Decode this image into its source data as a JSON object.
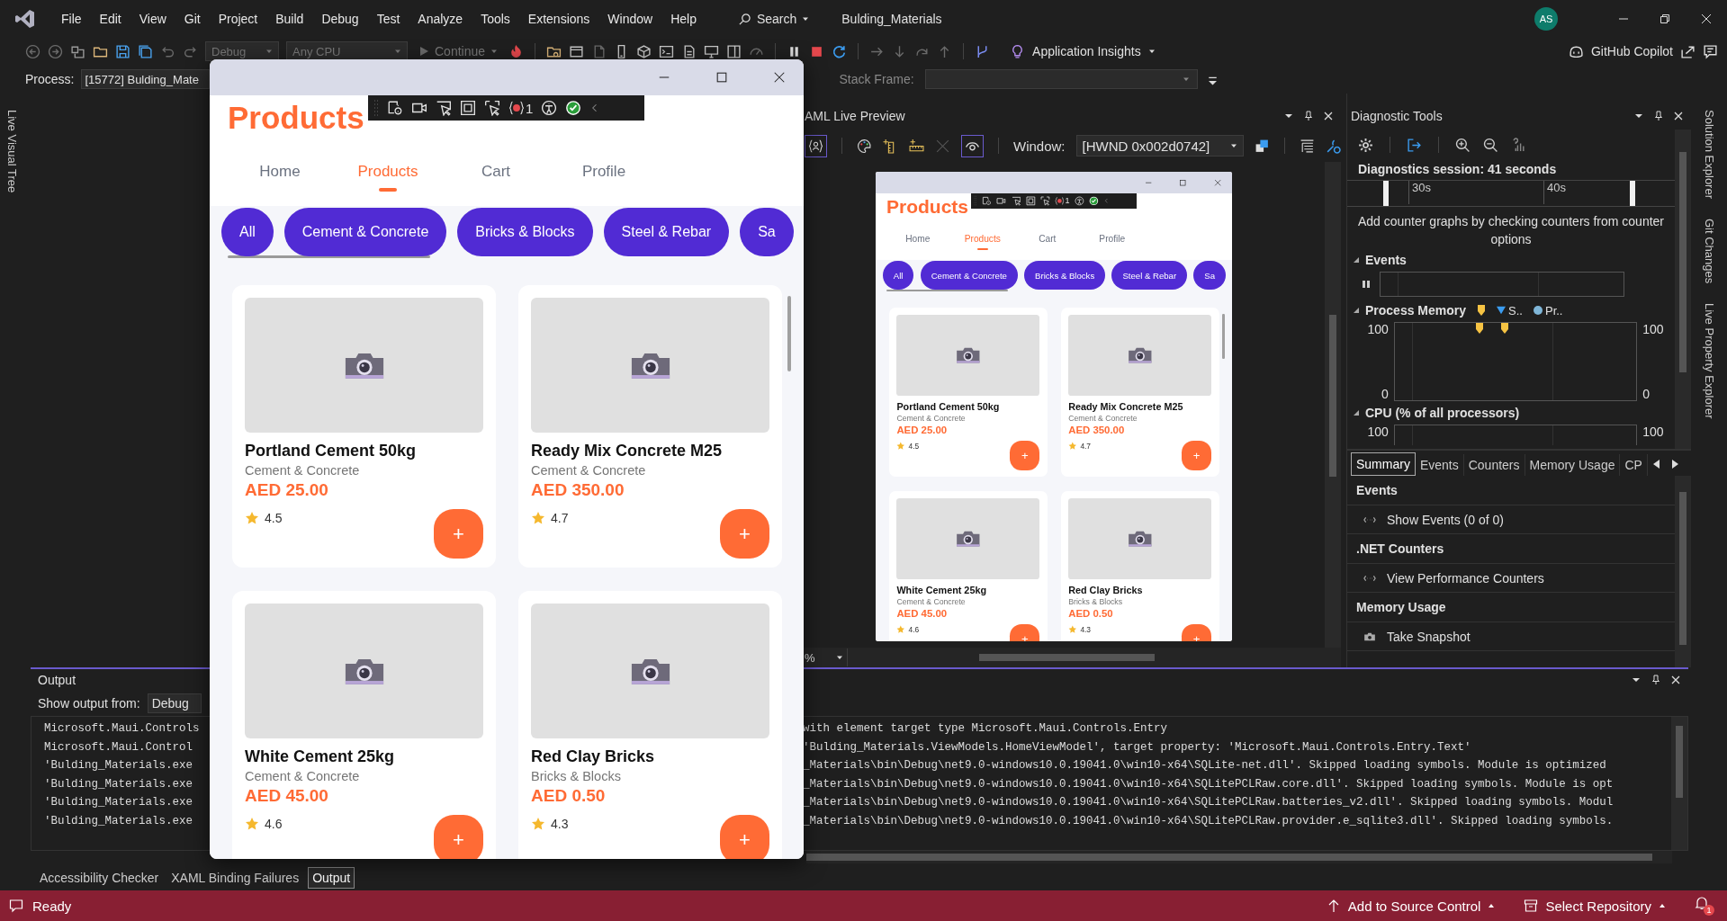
{
  "menu_bar": {
    "items": [
      "File",
      "Edit",
      "View",
      "Git",
      "Project",
      "Build",
      "Debug",
      "Test",
      "Analyze",
      "Tools",
      "Extensions",
      "Window",
      "Help"
    ],
    "search": "Search",
    "solution": "Bulding_Materials",
    "avatar": "AS"
  },
  "toolbar": {
    "configuration": "Debug",
    "platform": "Any CPU",
    "continue": "Continue",
    "insights": "Application Insights",
    "copilot": "GitHub Copilot"
  },
  "process_bar": {
    "process_label": "Process:",
    "process_value": "[15772] Bulding_Mate",
    "stack_frame_label": "Stack Frame:"
  },
  "left_tabs": [
    "Live Visual Tree"
  ],
  "app_window": {
    "heading": "Products",
    "error_count": "1",
    "tabs": [
      {
        "label": "Home",
        "selected": false
      },
      {
        "label": "Products",
        "selected": true
      },
      {
        "label": "Cart",
        "selected": false
      },
      {
        "label": "Profile",
        "selected": false
      }
    ],
    "chips": [
      "All",
      "Cement & Concrete",
      "Bricks & Blocks",
      "Steel & Rebar",
      "Sa"
    ],
    "products": [
      {
        "name": "Portland Cement 50kg",
        "category": "Cement & Concrete",
        "price": "AED 25.00",
        "rating": "4.5",
        "add": "+"
      },
      {
        "name": "Ready Mix Concrete M25",
        "category": "Cement & Concrete",
        "price": "AED 350.00",
        "rating": "4.7",
        "add": "+"
      },
      {
        "name": "White Cement 25kg",
        "category": "Cement & Concrete",
        "price": "AED 45.00",
        "rating": "4.6",
        "add": "+"
      },
      {
        "name": "Red Clay Bricks",
        "category": "Bricks & Blocks",
        "price": "AED 0.50",
        "rating": "4.3",
        "add": "+"
      }
    ]
  },
  "xaml_live_preview": {
    "title": "AML Live Preview",
    "window_label": "Window:",
    "window_value": "[HWND 0x002d0742]",
    "zoom_value": "%",
    "app": {
      "heading": "Products",
      "error_count": "1",
      "tabs": [
        {
          "label": "Home",
          "selected": false
        },
        {
          "label": "Products",
          "selected": true
        },
        {
          "label": "Cart",
          "selected": false
        },
        {
          "label": "Profile",
          "selected": false
        }
      ],
      "chips": [
        "All",
        "Cement & Concrete",
        "Bricks & Blocks",
        "Steel & Rebar",
        "Sa"
      ],
      "products": [
        {
          "name": "Portland Cement 50kg",
          "category": "Cement & Concrete",
          "price": "AED 25.00",
          "rating": "4.5",
          "add": "+"
        },
        {
          "name": "Ready Mix Concrete M25",
          "category": "Cement & Concrete",
          "price": "AED 350.00",
          "rating": "4.7",
          "add": "+"
        },
        {
          "name": "White Cement 25kg",
          "category": "Cement & Concrete",
          "price": "AED 45.00",
          "rating": "4.6",
          "add": "+"
        },
        {
          "name": "Red Clay Bricks",
          "category": "Bricks & Blocks",
          "price": "AED 0.50",
          "rating": "4.3",
          "add": "+"
        }
      ]
    }
  },
  "diagnostic_tools": {
    "title": "Diagnostic Tools",
    "session": "Diagnostics session: 41 seconds",
    "ticks": [
      "30s",
      "40s"
    ],
    "hint": "Add counter graphs by checking counters from counter options",
    "events": {
      "title": "Events"
    },
    "process_memory": {
      "title": "Process Memory",
      "legend": [
        "S..",
        "Pr.."
      ],
      "left_max": "100",
      "left_min": "0",
      "right_max": "100",
      "right_min": "0"
    },
    "cpu": {
      "title": "CPU (% of all processors)",
      "left_max": "100",
      "right_max": "100"
    },
    "tabs": [
      {
        "label": "Summary",
        "selected": true
      },
      {
        "label": "Events",
        "selected": false
      },
      {
        "label": "Counters",
        "selected": false
      },
      {
        "label": "Memory Usage",
        "selected": false
      },
      {
        "label": "CP",
        "selected": false
      }
    ],
    "summary": [
      {
        "heading": "Events",
        "action": "Show Events (0 of 0)",
        "kind": "link"
      },
      {
        "heading": ".NET Counters",
        "action": "View Performance Counters",
        "kind": "link"
      },
      {
        "heading": "Memory Usage",
        "action": "Take Snapshot",
        "kind": "snapshot"
      }
    ]
  },
  "right_tabs": [
    "Solution Explorer",
    "Git Changes",
    "Live Property Explorer"
  ],
  "output": {
    "title": "Output",
    "source_label": "Show output from:",
    "source_value": "Debug",
    "lines": [
      {
        "start": "Microsoft.Maui.Controls",
        "end": "with element target type Microsoft.Maui.Controls.Entry"
      },
      {
        "start": "Microsoft.Maui.Control",
        "end": "'Bulding_Materials.ViewModels.HomeViewModel', target property: 'Microsoft.Maui.Controls.Entry.Text'"
      },
      {
        "start": "'Bulding_Materials.exe",
        "end": "_Materials\\bin\\Debug\\net9.0-windows10.0.19041.0\\win10-x64\\SQLite-net.dll'. Skipped loading symbols. Module is optimized"
      },
      {
        "start": "'Bulding_Materials.exe",
        "end": "_Materials\\bin\\Debug\\net9.0-windows10.0.19041.0\\win10-x64\\SQLitePCLRaw.core.dll'. Skipped loading symbols. Module is opt"
      },
      {
        "start": "'Bulding_Materials.exe",
        "end": "_Materials\\bin\\Debug\\net9.0-windows10.0.19041.0\\win10-x64\\SQLitePCLRaw.batteries_v2.dll'. Skipped loading symbols. Modul"
      },
      {
        "start": "'Bulding_Materials.exe",
        "end": "_Materials\\bin\\Debug\\net9.0-windows10.0.19041.0\\win10-x64\\SQLitePCLRaw.provider.e_sqlite3.dll'. Skipped loading symbols."
      }
    ]
  },
  "bottom_tabs": [
    {
      "label": "Accessibility Checker",
      "selected": false
    },
    {
      "label": "XAML Binding Failures",
      "selected": false
    },
    {
      "label": "Output",
      "selected": true
    }
  ],
  "status_bar": {
    "status": "Ready",
    "source_control": "Add to Source Control",
    "repository": "Select Repository",
    "notifications": "1"
  }
}
